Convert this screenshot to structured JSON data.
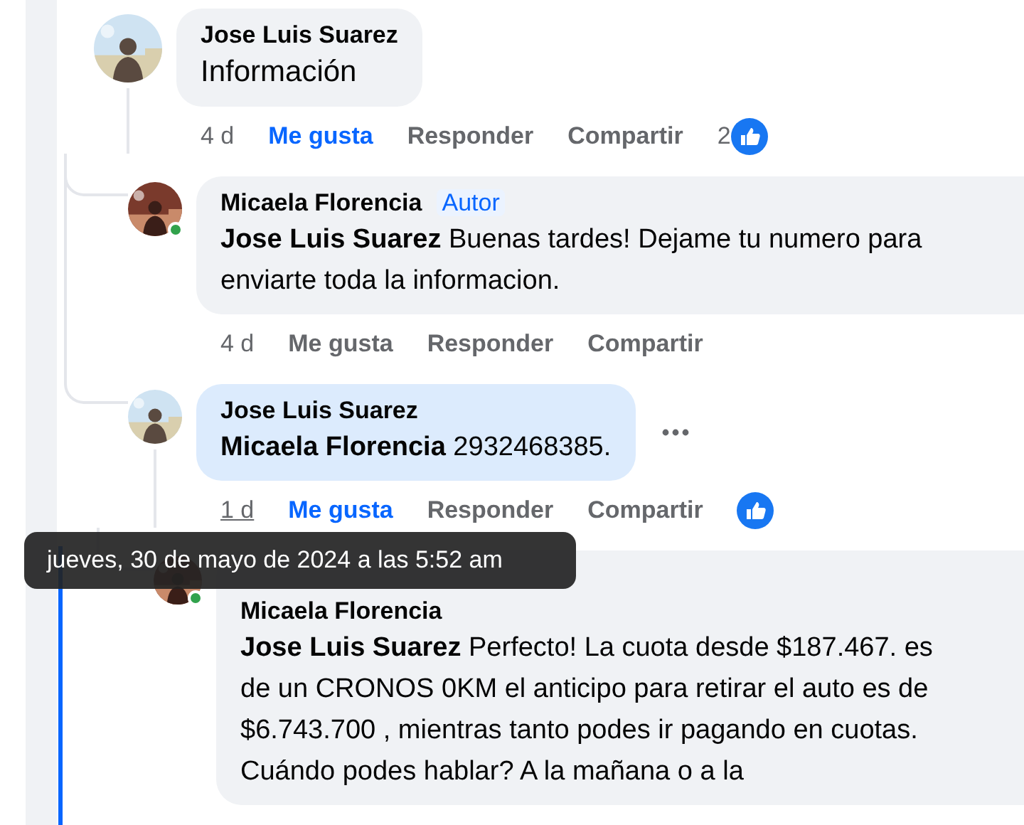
{
  "comments": [
    {
      "author": "Jose Luis Suarez",
      "text": "Información",
      "avatar": {
        "kind": "picture"
      },
      "highlighted": false,
      "time": "4 d",
      "time_hovered": false,
      "actions": {
        "like": "Me gusta",
        "reply": "Responder",
        "share": "Compartir"
      },
      "liked": true,
      "reaction_icon": true,
      "reaction_count": "2",
      "children": [
        {
          "author": "Micaela Florencia",
          "badge": "Autor",
          "text": "**Jose Luis Suarez** Buenas tardes! Dejame tu numero para enviarte toda la informacion.",
          "avatar": {
            "kind": "picture"
          },
          "online": true,
          "highlighted": false,
          "time": "4 d",
          "time_hovered": false,
          "actions": {
            "like": "Me gusta",
            "reply": "Responder",
            "share": "Compartir"
          },
          "liked": false
        },
        {
          "author": "Jose Luis Suarez",
          "text": "**Micaela Florencia** 2932468385.",
          "avatar": {
            "kind": "picture"
          },
          "highlighted": true,
          "more_button": true,
          "time": "1 d",
          "time_hovered": true,
          "actions": {
            "like": "Me gusta",
            "reply": "Responder",
            "share": "Compartir"
          },
          "liked": true,
          "reaction_icon": true,
          "children": [
            {
              "author": "Micaela Florencia",
              "text": "**Jose Luis Suarez** Perfecto! La cuota desde $187.467. es de un CRONOS 0KM el anticipo para retirar el auto es de $6.743.700 , mientras tanto podes ir pagando en cuotas. Cuándo podes hablar? A la mañana o a la",
              "avatar": {
                "kind": "picture"
              },
              "online": true,
              "highlighted": false
            }
          ]
        }
      ]
    }
  ],
  "tooltip": "jueves, 30 de mayo de 2024 a las 5:52 am"
}
